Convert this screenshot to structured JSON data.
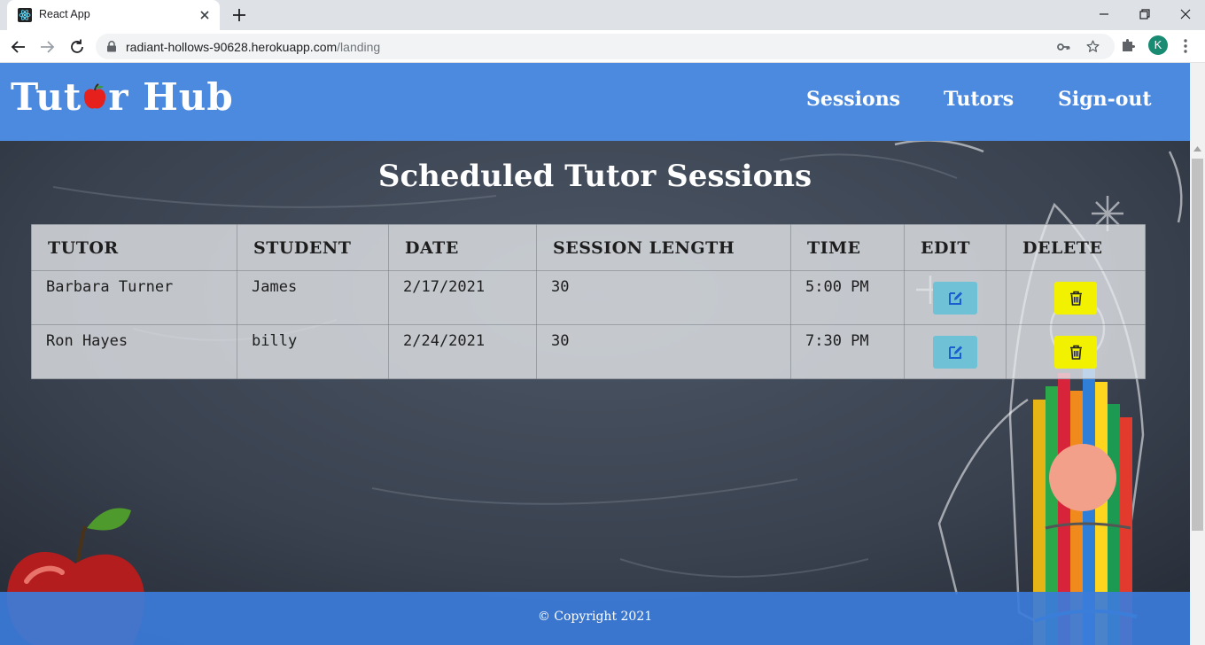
{
  "browser": {
    "tab_title": "React App",
    "url_host": "radiant-hollows-90628.herokuapp.com",
    "url_path": "/landing",
    "profile_initial": "K"
  },
  "site": {
    "logo_prefix": "Tut",
    "logo_suffix": "r Hub",
    "nav": [
      "Sessions",
      "Tutors",
      "Sign-out"
    ]
  },
  "page": {
    "title": "Scheduled Tutor Sessions"
  },
  "table": {
    "headers": [
      "TUTOR",
      "STUDENT",
      "DATE",
      "SESSION LENGTH",
      "TIME",
      "EDIT",
      "DELETE"
    ],
    "rows": [
      [
        "Barbara Turner",
        "James",
        "2/17/2021",
        "30",
        "5:00 PM"
      ],
      [
        "Ron Hayes",
        "billy",
        "2/24/2021",
        "30",
        "7:30 PM"
      ]
    ]
  },
  "footer": {
    "text": "© Copyright 2021"
  },
  "colors": {
    "header_blue": "#4c8adf",
    "edit_button": "#6fc1d6",
    "delete_button": "#f2f200"
  },
  "icons": [
    "react-favicon",
    "close-icon",
    "plus-icon",
    "back-arrow-icon",
    "forward-arrow-icon",
    "reload-icon",
    "lock-icon",
    "key-icon",
    "star-icon",
    "puzzle-icon",
    "kebab-menu-icon",
    "edit-icon",
    "trash-icon"
  ]
}
